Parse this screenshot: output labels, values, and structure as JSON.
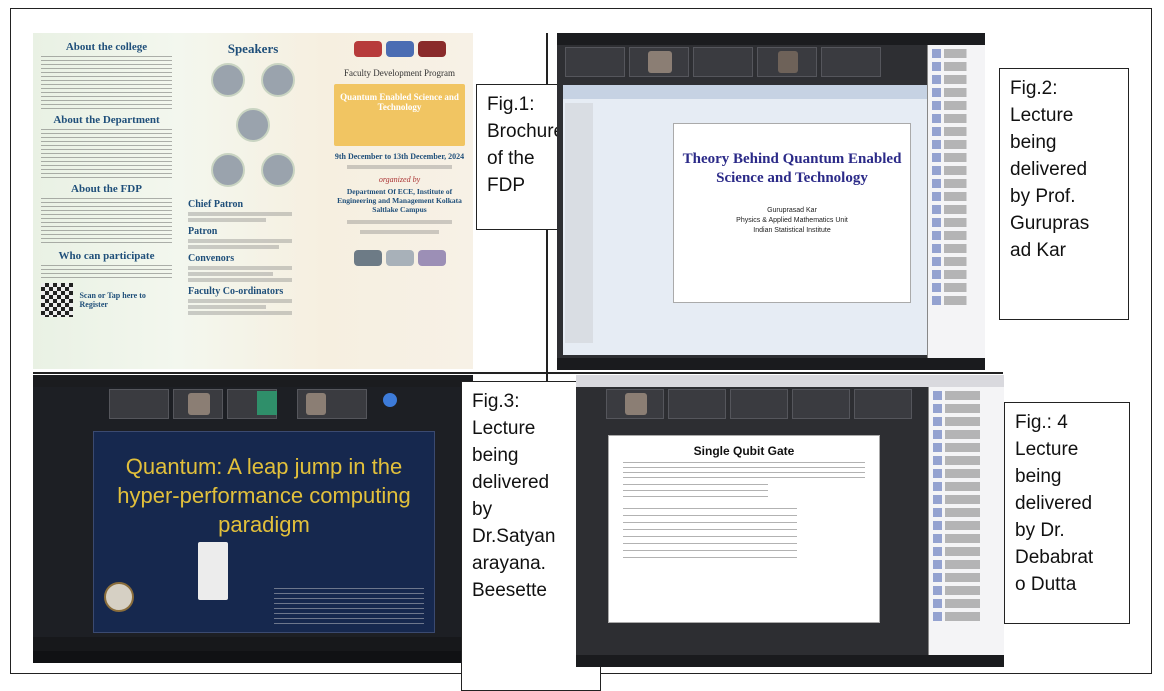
{
  "captions": {
    "fig1": "Fig.1:\nBrochure\nof the\nFDP",
    "fig2": "Fig.2:\nLecture\nbeing\ndelivered\nby Prof.\nGurupras\nad Kar",
    "fig3": "Fig.3:\nLecture\nbeing\ndelivered\nby\nDr.Satyan\narayana.\nBeesette",
    "fig4": "Fig.: 4\nLecture\nbeing\ndelivered\nby Dr.\nDebabrat\no Dutta"
  },
  "brochure": {
    "col1": [
      "About the college",
      "About the Department",
      "About the FDP",
      "Who can participate"
    ],
    "speakers_heading": "Speakers",
    "patrons": [
      "Chief Patron",
      "Patron",
      "Convenors",
      "Faculty Co-ordinators"
    ],
    "program": "Faculty Development Program",
    "theme": "Quantum Enabled Science and Technology",
    "dates": "9th December to 13th December, 2024",
    "organized_by": "organized by",
    "department": "Department Of ECE, Institute of Engineering and Management Kolkata Saltlake Campus",
    "scan": "Scan or Tap here to Register"
  },
  "slide2": {
    "title": "Theory Behind Quantum Enabled Science and Technology",
    "presenter": "Guruprasad Kar",
    "unit": "Physics & Applied Mathematics Unit",
    "institute": "Indian Statistical Institute"
  },
  "slide3": {
    "title": "Quantum: A leap jump in the hyper-performance computing paradigm"
  },
  "slide4": {
    "title": "Single Qubit Gate"
  },
  "colors": {
    "border": "#222222",
    "slide3_bg": "#16284e",
    "slide3_text": "#e2c03b",
    "slide2_text": "#2b2a88"
  }
}
